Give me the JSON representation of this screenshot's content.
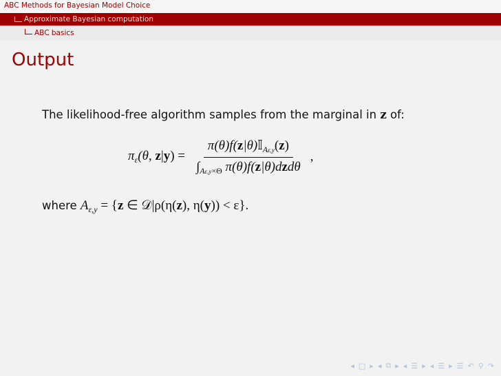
{
  "header": {
    "presentation_title": "ABC Methods for Bayesian Model Choice",
    "section": "Approximate Bayesian computation",
    "subsection": "ABC basics"
  },
  "frame": {
    "title": "Output",
    "intro_text": "The likelihood-free algorithm samples from the marginal in ",
    "intro_var": "z",
    "intro_end": " of:",
    "equation": {
      "lhs_pi": "π",
      "lhs_sub": "ε",
      "lhs_args_a": "(θ, ",
      "lhs_z": "z",
      "lhs_bar": "|",
      "lhs_y": "y",
      "lhs_close": ") =",
      "numerator_a": "π(θ)f(",
      "numerator_z": "z",
      "numerator_b": "|θ)",
      "numerator_I": "𝕀",
      "numerator_sub": "A",
      "numerator_sub2": "ε,y",
      "numerator_c": "(",
      "numerator_z2": "z",
      "numerator_d": ")",
      "denominator_int": "∫",
      "denominator_sub": "A",
      "denominator_sub2": "ε,y",
      "denominator_sub3": "×Θ",
      "denominator_a": " π(θ)f(",
      "denominator_z": "z",
      "denominator_b": "|θ)d",
      "denominator_z2": "z",
      "denominator_c": "dθ",
      "trailing": ","
    },
    "where_label": "where ",
    "where_A": "A",
    "where_A_sub": "ε,y",
    "where_eq": " = {",
    "where_z": "z",
    "where_rest_a": " ∈ 𝒟|ρ(η(",
    "where_z2": "z",
    "where_rest_b": "), η(",
    "where_y": "y",
    "where_rest_c": ")) < ε}."
  },
  "navigation": {
    "icons": [
      "frame-prev-icon",
      "frame-icon",
      "frame-next-icon",
      "subsection-prev-icon",
      "subsection-icon",
      "subsection-next-icon",
      "section-prev-icon",
      "section-icon",
      "section-next-icon",
      "document-icon",
      "back-icon",
      "search-icon",
      "forward-icon"
    ],
    "glyphs": [
      "◂",
      "□",
      "▸",
      "◂",
      "⧉",
      "▸",
      "◂",
      "☰",
      "▸",
      "◂",
      "☰",
      "▸",
      "☰",
      "↶",
      "⚲",
      "↷"
    ],
    "accent_color": "#a00000"
  }
}
